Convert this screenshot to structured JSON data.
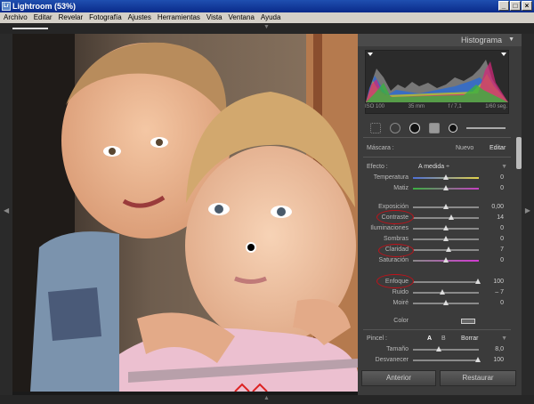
{
  "window": {
    "title": "Lightroom (53%)",
    "icon": "Lr",
    "buttons": [
      "_",
      "□",
      "×"
    ]
  },
  "menu": [
    "Archivo",
    "Editar",
    "Revelar",
    "Fotografía",
    "Ajustes",
    "Herramientas",
    "Vista",
    "Ventana",
    "Ayuda"
  ],
  "panel": {
    "histogram_title": "Histograma",
    "histogram_info": {
      "iso": "ISO 100",
      "focal": "35 mm",
      "aperture": "f / 7,1",
      "shutter": "1/60 seg."
    },
    "mask": {
      "label": "Máscara :",
      "new": "Nuevo",
      "edit": "Editar"
    },
    "effect": {
      "label": "Efecto :",
      "value": "A medida ÷"
    },
    "sliders_a": [
      {
        "label": "Temperatura",
        "value": "0"
      },
      {
        "label": "Matiz",
        "value": "0"
      }
    ],
    "sliders_b": [
      {
        "label": "Exposición",
        "value": "0,00"
      },
      {
        "label": "Contraste",
        "value": "14"
      },
      {
        "label": "Iluminaciones",
        "value": "0"
      },
      {
        "label": "Sombras",
        "value": "0"
      },
      {
        "label": "Claridad",
        "value": "7"
      },
      {
        "label": "Saturación",
        "value": "0"
      }
    ],
    "sliders_c": [
      {
        "label": "Enfoque",
        "value": "100"
      },
      {
        "label": "Ruido",
        "value": "– 7"
      },
      {
        "label": "Moiré",
        "value": "0"
      }
    ],
    "color_label": "Color",
    "brush": {
      "label": "Pincel :",
      "a": "A",
      "b": "B",
      "erase": "Borrar"
    },
    "brush_sliders": [
      {
        "label": "Tamaño",
        "value": "8,0"
      },
      {
        "label": "Desvanecer",
        "value": "100"
      }
    ],
    "buttons": {
      "previous": "Anterior",
      "reset": "Restaurar"
    }
  }
}
